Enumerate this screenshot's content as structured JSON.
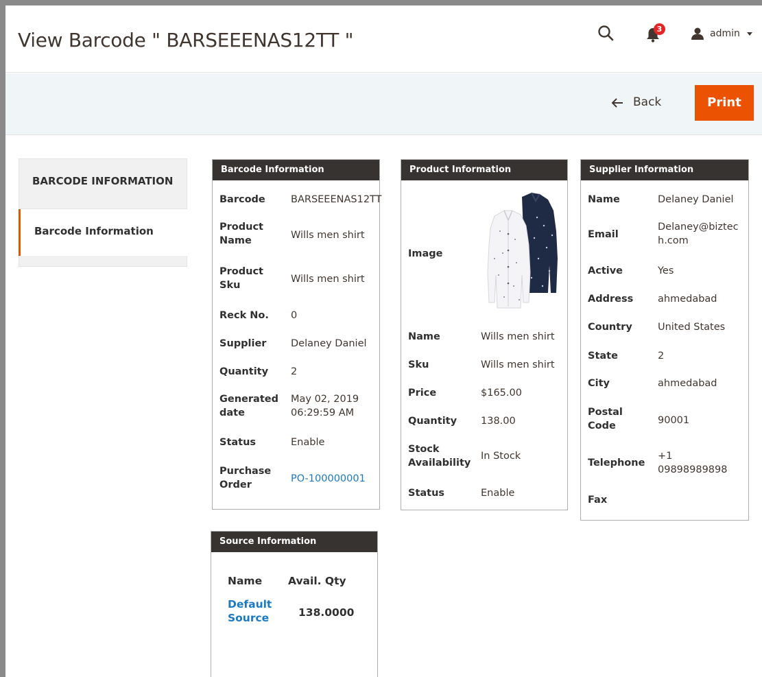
{
  "header": {
    "title": "View Barcode \" BARSEEENAS12TT \"",
    "notifications_count": "3",
    "user_label": "admin"
  },
  "actions": {
    "back_label": "Back",
    "print_label": "Print"
  },
  "sidebar": {
    "title": "BARCODE INFORMATION",
    "items": [
      {
        "label": "Barcode Information"
      }
    ]
  },
  "barcode_panel": {
    "title": "Barcode Information",
    "rows": [
      {
        "label": "Barcode",
        "value": "BARSEEENAS12TT"
      },
      {
        "label": "Product Name",
        "value": "Wills men shirt"
      },
      {
        "label": "Product Sku",
        "value": "Wills men shirt"
      },
      {
        "label": "Reck No.",
        "value": "0"
      },
      {
        "label": "Supplier",
        "value": "Delaney Daniel"
      },
      {
        "label": "Quantity",
        "value": "2"
      },
      {
        "label": "Generated date",
        "value": "May 02, 2019 06:29:59 AM"
      },
      {
        "label": "Status",
        "value": "Enable"
      },
      {
        "label": "Purchase Order",
        "value": "PO-100000001"
      }
    ]
  },
  "product_panel": {
    "title": "Product Information",
    "image_label": "Image",
    "rows": [
      {
        "label": "Name",
        "value": "Wills men shirt"
      },
      {
        "label": "Sku",
        "value": "Wills men shirt"
      },
      {
        "label": "Price",
        "value": "$165.00"
      },
      {
        "label": "Quantity",
        "value": "138.00"
      },
      {
        "label": "Stock Availability",
        "value": "In Stock"
      },
      {
        "label": "Status",
        "value": "Enable"
      }
    ]
  },
  "supplier_panel": {
    "title": "Supplier Information",
    "rows": [
      {
        "label": "Name",
        "value": "Delaney Daniel"
      },
      {
        "label": "Email",
        "value": "Delaney@biztech.com"
      },
      {
        "label": "Active",
        "value": "Yes"
      },
      {
        "label": "Address",
        "value": "ahmedabad"
      },
      {
        "label": "Country",
        "value": "United States"
      },
      {
        "label": "State",
        "value": "2"
      },
      {
        "label": "City",
        "value": "ahmedabad"
      },
      {
        "label": "Postal Code",
        "value": "90001"
      },
      {
        "label": "Telephone",
        "value": "+1 09898989898"
      },
      {
        "label": "Fax",
        "value": ""
      }
    ]
  },
  "source_panel": {
    "title": "Source Information",
    "headers": {
      "name": "Name",
      "qty": "Avail. Qty"
    },
    "rows": [
      {
        "name": "Default Source",
        "qty": "138.0000"
      }
    ]
  },
  "colors": {
    "accent": "#eb5202",
    "panel_header": "#373330",
    "link": "#1979c3"
  }
}
